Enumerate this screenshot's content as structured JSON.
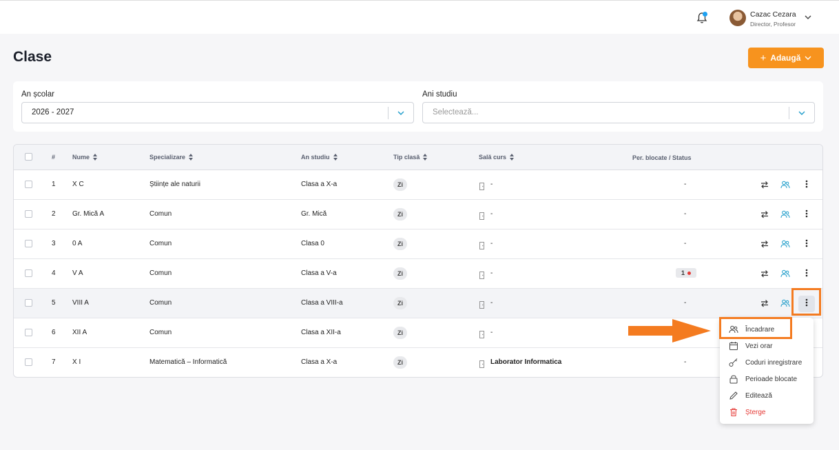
{
  "header": {
    "user_name": "Cazac Cezara",
    "user_role": "Director, Profesor",
    "notification_dot_color": "#1da1f2"
  },
  "page": {
    "title": "Clase",
    "add_button_label": "Adaugă",
    "accent_color": "#f7931e"
  },
  "filters": {
    "year_label": "An școlar",
    "year_value": "2026 - 2027",
    "study_label": "Ani studiu",
    "study_placeholder": "Selectează..."
  },
  "table": {
    "headers": {
      "index": "#",
      "name": "Nume",
      "specialization": "Specializare",
      "study_year": "An studiu",
      "class_type": "Tip clasă",
      "room": "Sală curs",
      "status": "Per. blocate / Status"
    },
    "rows": [
      {
        "index": "1",
        "name": "X C",
        "specialization": "Științe ale naturii",
        "study_year": "Clasa a X-a",
        "type": "Zi",
        "room": "-",
        "status": "-"
      },
      {
        "index": "2",
        "name": "Gr. Mică A",
        "specialization": "Comun",
        "study_year": "Gr. Mică",
        "type": "Zi",
        "room": "-",
        "status": "-"
      },
      {
        "index": "3",
        "name": "0 A",
        "specialization": "Comun",
        "study_year": "Clasa 0",
        "type": "Zi",
        "room": "-",
        "status": "-"
      },
      {
        "index": "4",
        "name": "V A",
        "specialization": "Comun",
        "study_year": "Clasa a V-a",
        "type": "Zi",
        "room": "-",
        "status": "1"
      },
      {
        "index": "5",
        "name": "VIII A",
        "specialization": "Comun",
        "study_year": "Clasa a VIII-a",
        "type": "Zi",
        "room": "-",
        "status": "-"
      },
      {
        "index": "6",
        "name": "XII A",
        "specialization": "Comun",
        "study_year": "Clasa a XII-a",
        "type": "Zi",
        "room": "-",
        "status": ""
      },
      {
        "index": "7",
        "name": "X I",
        "specialization": "Matematică – Informatică",
        "study_year": "Clasa a X-a",
        "type": "Zi",
        "room": "Laborator Informatica",
        "status": "-"
      }
    ]
  },
  "context_menu": {
    "items": [
      {
        "label": "Încadrare",
        "icon": "users-icon"
      },
      {
        "label": "Vezi orar",
        "icon": "calendar-icon"
      },
      {
        "label": "Coduri inregistrare",
        "icon": "key-icon"
      },
      {
        "label": "Perioade blocate",
        "icon": "lock-icon"
      },
      {
        "label": "Editează",
        "icon": "pencil-icon"
      },
      {
        "label": "Șterge",
        "icon": "trash-icon"
      }
    ],
    "danger_color": "#e53935"
  },
  "annotation": {
    "highlight_color": "#f47b20"
  }
}
